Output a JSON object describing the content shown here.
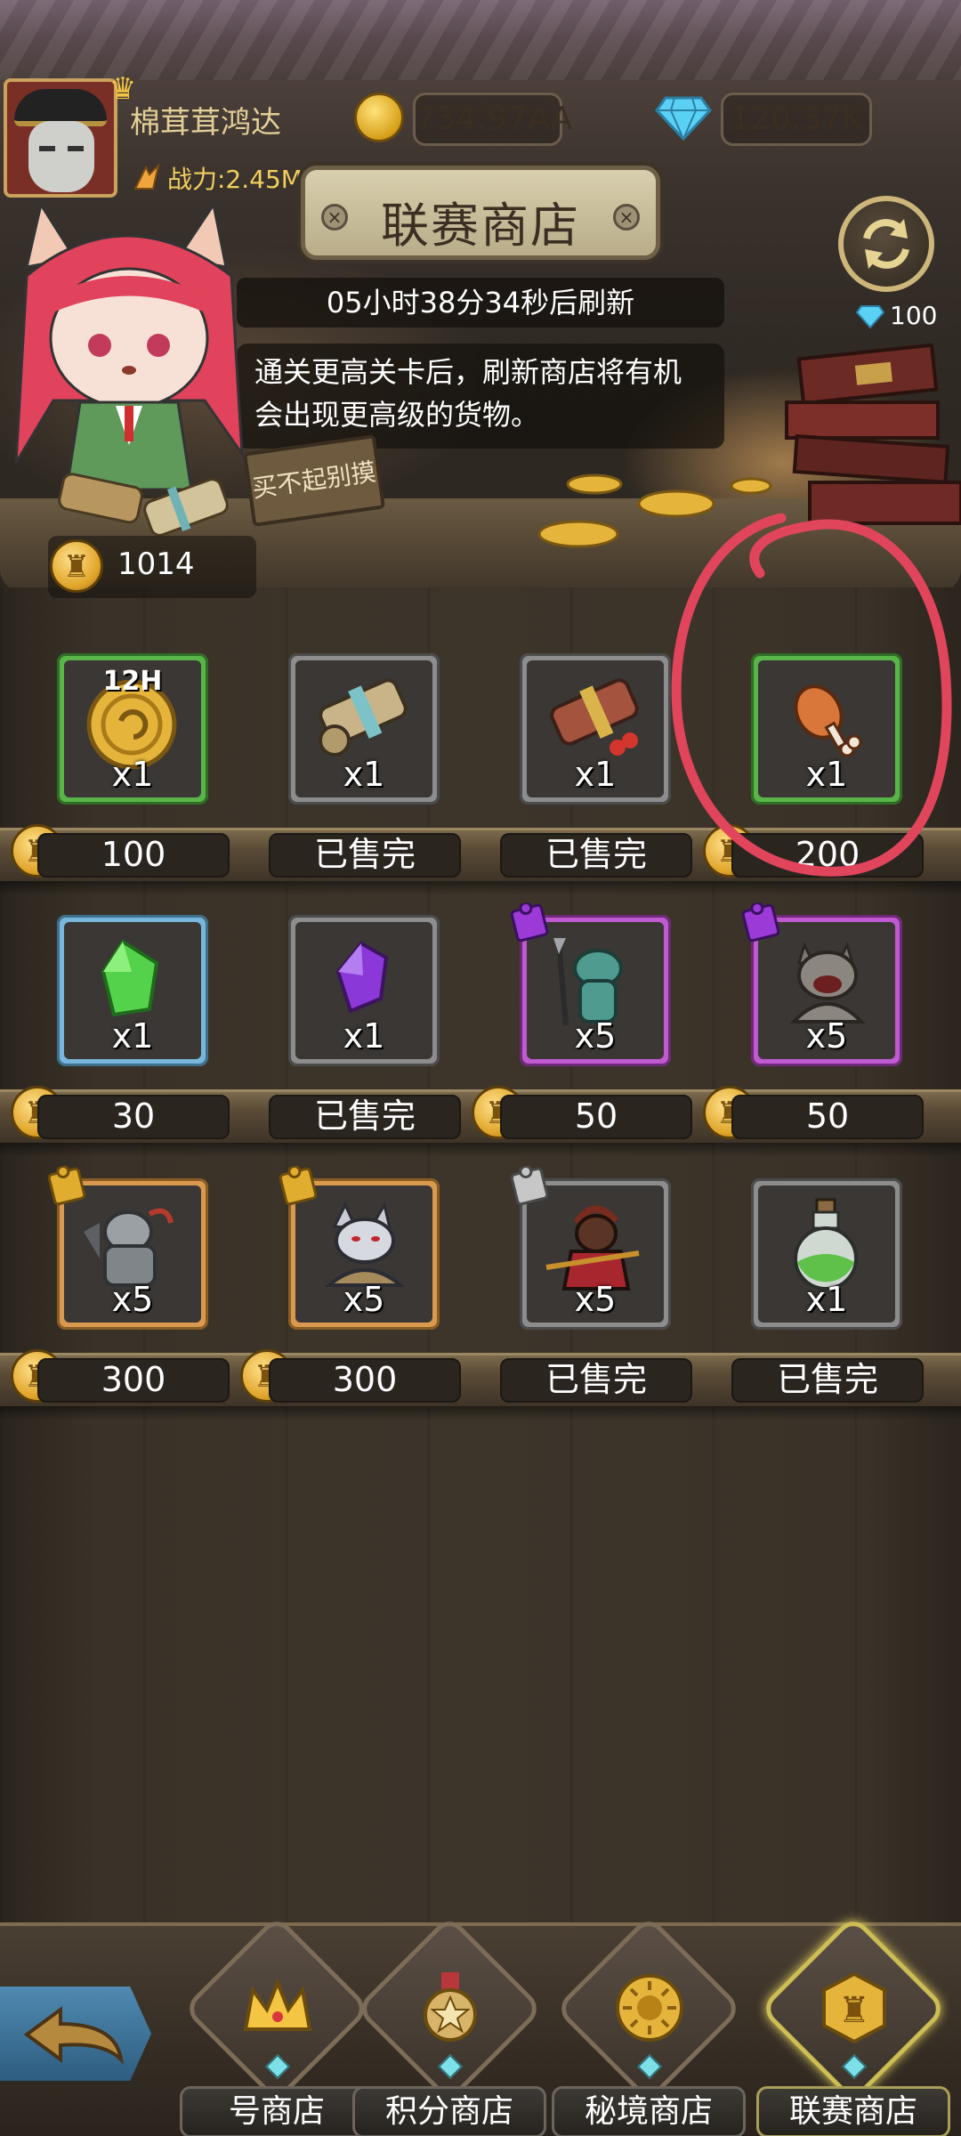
{
  "header": {
    "player_name": "棉茸茸鸿达",
    "power": "战力:2.45M",
    "gold": "734.97AA",
    "gems": "120.37K"
  },
  "shop": {
    "title": "联赛商店",
    "refresh_timer": "05小时38分34秒后刷新",
    "tip": "通关更高关卡后，刷新商店将有机会出现更高级的货物。",
    "sign": "买不起别摸",
    "refresh_cost": "100",
    "league_coins": "1014"
  },
  "items": [
    {
      "qty": "x1",
      "tag": "12H",
      "frame": "green",
      "icon": "gold-coin-12h",
      "price": "100",
      "sold_out": false
    },
    {
      "qty": "x1",
      "frame": "gray",
      "icon": "scroll-blue-ribbon",
      "price": "已售完",
      "sold_out": true
    },
    {
      "qty": "x1",
      "frame": "gray",
      "icon": "scroll-red-ribbon",
      "price": "已售完",
      "sold_out": true
    },
    {
      "qty": "x1",
      "frame": "green",
      "icon": "chicken-leg",
      "price": "200",
      "sold_out": false
    },
    {
      "qty": "x1",
      "frame": "blue",
      "icon": "green-gem",
      "price": "30",
      "sold_out": false
    },
    {
      "qty": "x1",
      "frame": "gray",
      "icon": "purple-gem",
      "price": "已售完",
      "sold_out": true
    },
    {
      "qty": "x5",
      "frame": "purple",
      "icon": "lizard-warrior-shard",
      "price": "50",
      "sold_out": false
    },
    {
      "qty": "x5",
      "frame": "purple",
      "icon": "werewolf-shard",
      "price": "50",
      "sold_out": false
    },
    {
      "qty": "x5",
      "frame": "orange",
      "icon": "armored-beast-shard",
      "price": "300",
      "sold_out": false
    },
    {
      "qty": "x5",
      "frame": "orange",
      "icon": "white-wolf-shard",
      "price": "300",
      "sold_out": false
    },
    {
      "qty": "x5",
      "frame": "gray",
      "icon": "monkey-warrior-shard",
      "price": "已售完",
      "sold_out": true
    },
    {
      "qty": "x1",
      "frame": "gray",
      "icon": "green-potion",
      "price": "已售完",
      "sold_out": true
    }
  ],
  "nav": {
    "tabs": [
      {
        "label": "号商店",
        "icon": "crown-icon",
        "active": false
      },
      {
        "label": "积分商店",
        "icon": "star-medal-icon",
        "active": false
      },
      {
        "label": "秘境商店",
        "icon": "sun-coin-icon",
        "active": false
      },
      {
        "label": "联赛商店",
        "icon": "league-coin-icon",
        "active": true
      }
    ]
  },
  "colors": {
    "frame_green": "#59b548",
    "frame_gray": "#8d8d8d",
    "frame_blue": "#78b6dc",
    "frame_purple": "#c05ad0",
    "frame_orange": "#d99a4f",
    "annotation_red": "#e0455c"
  }
}
